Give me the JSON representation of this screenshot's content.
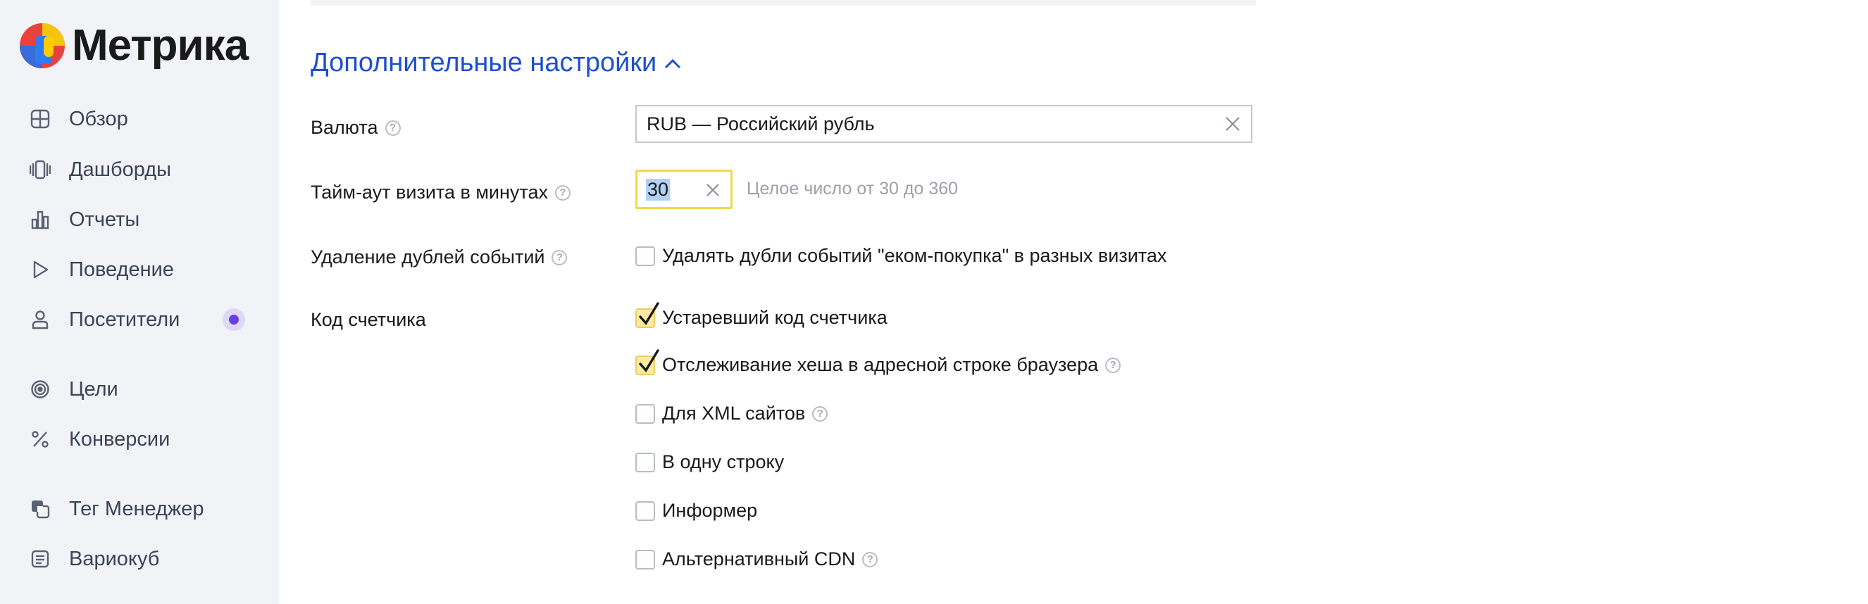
{
  "app": {
    "logo_text": "Метрика"
  },
  "sidebar": {
    "items": [
      {
        "label": "Обзор",
        "icon": "overview-grid-icon"
      },
      {
        "label": "Дашборды",
        "icon": "dashboards-icon"
      },
      {
        "label": "Отчеты",
        "icon": "reports-bar-icon"
      },
      {
        "label": "Поведение",
        "icon": "play-icon"
      },
      {
        "label": "Посетители",
        "icon": "person-icon",
        "badge": "new-dot"
      },
      {
        "label": "Цели",
        "icon": "target-icon"
      },
      {
        "label": "Конверсии",
        "icon": "percent-icon"
      },
      {
        "label": "Тег Менеджер",
        "icon": "tag-manager-icon"
      },
      {
        "label": "Вариокуб",
        "icon": "variocube-icon"
      }
    ]
  },
  "settings": {
    "section_title": "Дополнительные настройки",
    "currency": {
      "label": "Валюта",
      "value": "RUB — Российский рубль"
    },
    "timeout": {
      "label": "Тайм-аут визита в минутах",
      "value": "30",
      "hint": "Целое число от 30 до 360"
    },
    "dedup": {
      "label": "Удаление дублей событий",
      "checkbox_label": "Удалять дубли событий \"еком-покупка\" в разных визитах",
      "checked": false
    },
    "counter_code": {
      "label": "Код счетчика",
      "options": [
        {
          "label": "Устаревший код счетчика",
          "checked": true,
          "help": false
        },
        {
          "label": "Отслеживание хеша в адресной строке браузера",
          "checked": true,
          "help": true
        },
        {
          "label": "Для XML сайтов",
          "checked": false,
          "help": true
        },
        {
          "label": "В одну строку",
          "checked": false,
          "help": false
        },
        {
          "label": "Информер",
          "checked": false,
          "help": false
        },
        {
          "label": "Альтернативный CDN",
          "checked": false,
          "help": true
        }
      ]
    }
  },
  "colors": {
    "accent": "#1d4fcf",
    "focus": "#f5d84a",
    "sidebar_bg": "#f2f3f7",
    "badge": "#6a3fe0"
  }
}
